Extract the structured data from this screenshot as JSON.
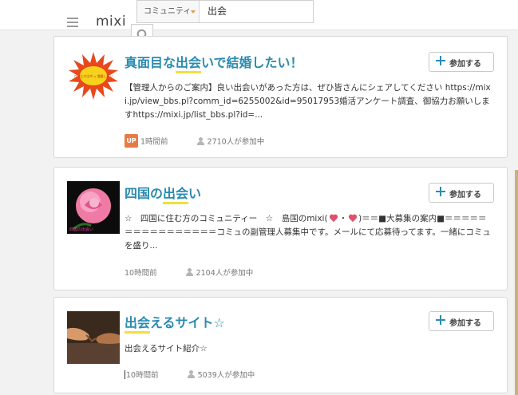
{
  "header": {
    "logo": "mixi",
    "search_category": "コミュニティ",
    "search_query": "出会"
  },
  "colors": {
    "accent_title": "#2a8bb0",
    "highlight": "#f4dd3e",
    "up_badge": "#e67c44"
  },
  "communities": [
    {
      "title_pre": "真面目な",
      "title_hl": "出会",
      "title_post": "いで結婚したい！",
      "join_label": "参加する",
      "description": "【管理人からのご案内】良い出会いがあった方は、ぜひ皆さんにシェアしてください https://mixi.jp/view_bbs.pl?comm_id=6255002&id=95017953婚活アンケート調査、御協力お願いしますhttps://mixi.jp/list_bbs.pl?id=...",
      "badge": "UP",
      "time": "1時間前",
      "members": "2710人が参加中",
      "thumb_text": "ガロとけばやっ 増量したい"
    },
    {
      "title_pre": "四国の",
      "title_hl": "出会",
      "title_post": "い",
      "join_label": "参加する",
      "desc_part1": "☆　四国に住む方のコミュニティー　☆　島国のmixi(",
      "desc_part2": "・",
      "desc_part3": ")＝＝■大募集の案内■＝＝＝＝＝＝＝＝＝＝＝＝＝＝＝＝コミュの副管理人募集中です。メールにて応募待ってます。一緒にコミュを盛り...",
      "time": "10時間前",
      "members": "2104人が参加中",
      "thumb_text": "四国の出会い"
    },
    {
      "title_pre": "",
      "title_hl": "出会",
      "title_post": "えるサイト☆",
      "join_label": "参加する",
      "description": "出会えるサイト紹介☆",
      "time": "10時間前",
      "members": "5039人が参加中"
    }
  ]
}
